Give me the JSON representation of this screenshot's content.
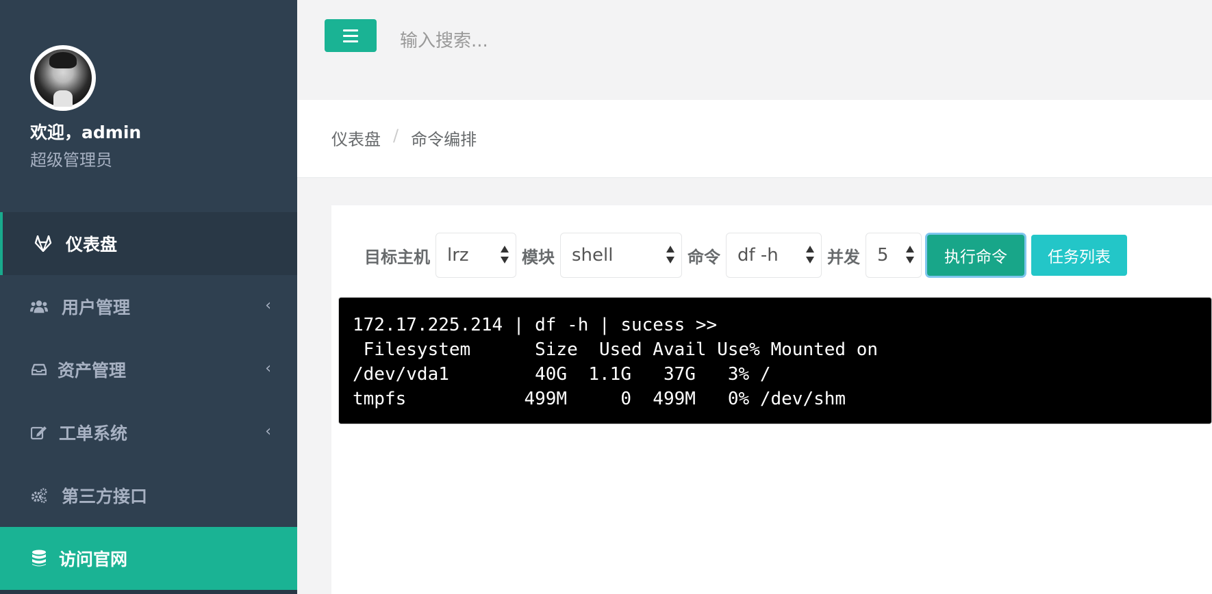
{
  "sidebar": {
    "welcome": "欢迎，admin",
    "role": "超级管理员",
    "items": [
      {
        "label": "仪表盘",
        "icon": "gitlab-icon",
        "active": true
      },
      {
        "label": "用户管理",
        "icon": "users-icon",
        "has_submenu": true
      },
      {
        "label": "资产管理",
        "icon": "inbox-icon",
        "has_submenu": true
      },
      {
        "label": "工单系统",
        "icon": "edit-icon",
        "has_submenu": true
      },
      {
        "label": "第三方接口",
        "icon": "gears-icon"
      },
      {
        "label": "访问官网",
        "icon": "database-icon",
        "highlight": true
      }
    ],
    "chevron": "‹"
  },
  "topbar": {
    "search_placeholder": "输入搜索..."
  },
  "breadcrumb": {
    "home": "仪表盘",
    "separator": "/",
    "current": "命令编排"
  },
  "form": {
    "host_label": "目标主机",
    "host_value": "lrz",
    "module_label": "模块",
    "module_value": "shell",
    "command_label": "命令",
    "command_value": "df -h",
    "concurrency_label": "并发",
    "concurrency_value": "5",
    "exec_button": "执行命令",
    "task_button": "任务列表"
  },
  "terminal": {
    "lines": [
      "172.17.225.214 | df -h | sucess >>",
      " Filesystem      Size  Used Avail Use% Mounted on",
      "/dev/vda1        40G  1.1G   37G   3% /",
      "tmpfs           499M     0  499M   0% /dev/shm"
    ]
  },
  "colors": {
    "sidebar_bg": "#2f4050",
    "accent": "#1ab394",
    "info": "#23c6c8"
  }
}
